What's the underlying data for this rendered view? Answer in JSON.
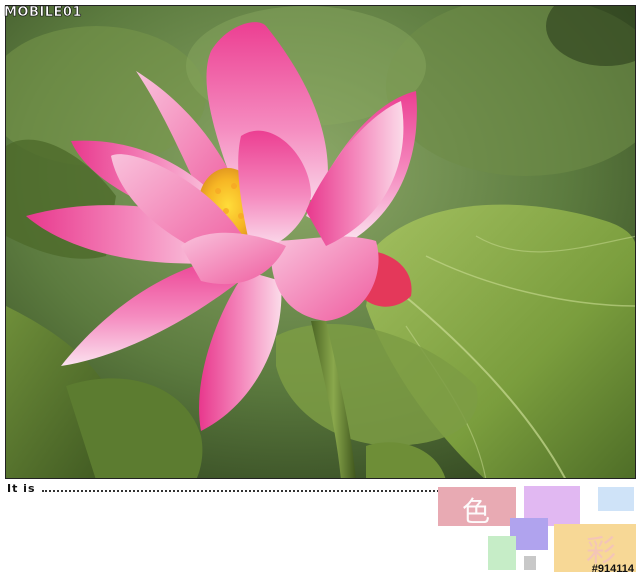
{
  "watermark": {
    "brand": "MOBILE01"
  },
  "photo": {
    "subject": "pink lotus flower"
  },
  "caption": {
    "label": "It is"
  },
  "color_card": {
    "char_1": "色",
    "char_2": "彩"
  },
  "photo_id": "#914114",
  "colors": {
    "block_pink": "#e8aab3",
    "block_lilac": "#e1b8f2",
    "block_light_blue": "#cfe3f8",
    "block_violet": "#b0a3ee",
    "block_green": "#c6edc7",
    "block_yellow": "#f7d896",
    "block_gray": "#c8c8c8"
  }
}
